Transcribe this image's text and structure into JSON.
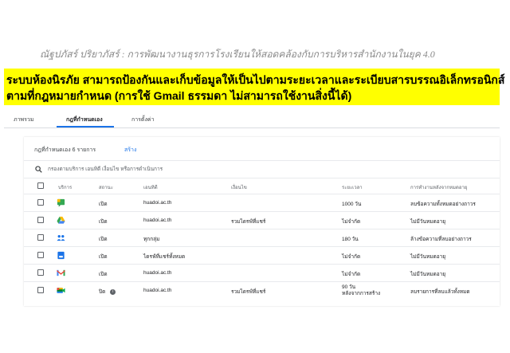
{
  "header": {
    "subtitle": "ณัฐปภัสร์  ปริยาภัสร์ : การพัฒนางานธุรการโรงเรียนให้สอดคล้องกับการบริหารสำนักงานในยุค 4.0"
  },
  "banner": {
    "line1": "ระบบห้องนิรภัย สามารถป้องกันและเก็บข้อมูลให้เป็นไปตามระยะเวลาและระเบียบสารบรรณอิเล็กทรอนิกส์",
    "line2": "ตามที่กฎหมายกำหนด  (การใช้ Gmail ธรรมดา ไม่สามารถใช้งานสิ่งนี้ได้)",
    "color": "#ffff00"
  },
  "tabs": [
    {
      "label": "ภาพรวม"
    },
    {
      "label": "กฎที่กำหนดเอง"
    },
    {
      "label": "การตั้งค่า"
    }
  ],
  "active_tab": "กฎที่กำหนดเอง",
  "panel": {
    "title": "กฎที่กำหนดเอง 6 รายการ",
    "create_label": "สร้าง",
    "search_placeholder": "กรองตามบริการ เอนทิตี เงื่อนไข หรือการดำเนินการ"
  },
  "columns": [
    "บริการ",
    "สถานะ",
    "เอนทิตี",
    "เงื่อนไข",
    "ระยะเวลา",
    "การทำงานหลังจากหมดอายุ"
  ],
  "rows": [
    {
      "icon": "google-chat-icon",
      "status": "เปิด",
      "entity": "huadoi.ac.th",
      "condition": "",
      "duration": "1000 วัน",
      "duration2": "",
      "action": "ลบข้อความทั้งหมดอย่างถาวร"
    },
    {
      "icon": "google-drive-icon",
      "status": "เปิด",
      "entity": "huadoi.ac.th",
      "condition": "รวมไดรฟ์ที่แชร์",
      "duration": "ไม่จำกัด",
      "duration2": "",
      "action": "ไม่มีวันหมดอายุ"
    },
    {
      "icon": "google-groups-icon",
      "status": "เปิด",
      "entity": "ทุกกลุ่ม",
      "condition": "",
      "duration": "180 วัน",
      "duration2": "",
      "action": "ล้างข้อความที่ลบอย่างถาวร"
    },
    {
      "icon": "google-vault-icon",
      "status": "เปิด",
      "entity": "ไดรฟ์ที่แชร์ทั้งหมด",
      "condition": "",
      "duration": "ไม่จำกัด",
      "duration2": "",
      "action": "ไม่มีวันหมดอายุ"
    },
    {
      "icon": "gmail-icon",
      "status": "เปิด",
      "entity": "huadoi.ac.th",
      "condition": "",
      "duration": "ไม่จำกัด",
      "duration2": "",
      "action": "ไม่มีวันหมดอายุ"
    },
    {
      "icon": "google-meet-icon",
      "status": "ปิด",
      "entity": "huadoi.ac.th",
      "condition": "รวมไดรฟ์ที่แชร์",
      "duration": "90 วัน",
      "duration2": "หลังจากการสร้าง",
      "action": "ลบรายการที่ลบแล้วทั้งหมด",
      "info": "i"
    }
  ],
  "colors": {
    "accent": "#1a73e8",
    "banner": "#ffff00"
  }
}
